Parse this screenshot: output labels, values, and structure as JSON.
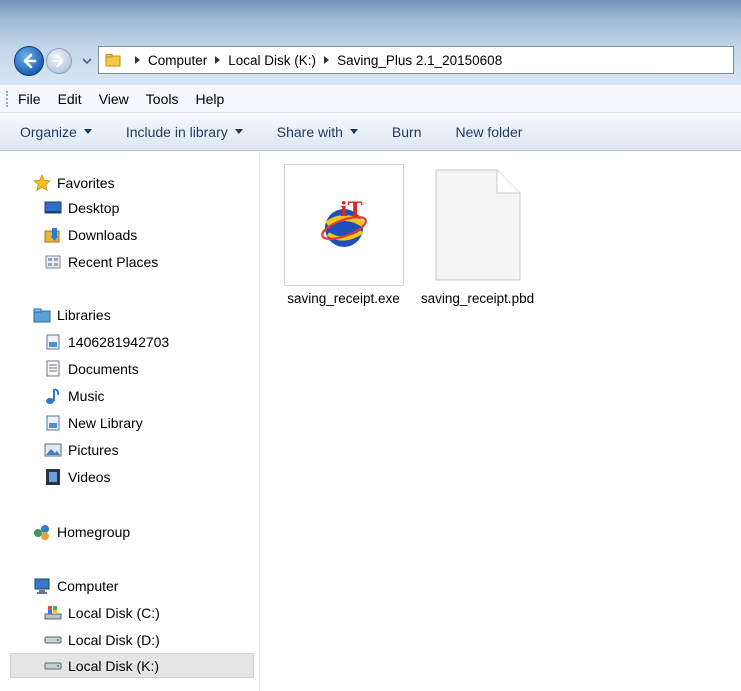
{
  "address": {
    "crumbs": [
      "Computer",
      "Local Disk (K:)",
      "Saving_Plus 2.1_20150608"
    ]
  },
  "menu": {
    "items": [
      "File",
      "Edit",
      "View",
      "Tools",
      "Help"
    ]
  },
  "commands": {
    "organize": "Organize",
    "include_in_library": "Include in library",
    "share_with": "Share with",
    "burn": "Burn",
    "new_folder": "New folder"
  },
  "nav": {
    "favorites": "Favorites",
    "desktop": "Desktop",
    "downloads": "Downloads",
    "recent_places": "Recent Places",
    "libraries": "Libraries",
    "lib_1406": "1406281942703",
    "documents": "Documents",
    "music": "Music",
    "new_library": "New Library",
    "pictures": "Pictures",
    "videos": "Videos",
    "homegroup": "Homegroup",
    "computer": "Computer",
    "disk_c": "Local Disk (C:)",
    "disk_d": "Local Disk (D:)",
    "disk_k": "Local Disk (K:)"
  },
  "files": [
    {
      "name": "saving_receipt.exe",
      "icon": "app-logo-icon"
    },
    {
      "name": "saving_receipt.pbd",
      "icon": "blank-document-icon"
    }
  ],
  "colors": {
    "command_text": "#1e395b",
    "selection_bg": "#e5e5e5"
  }
}
